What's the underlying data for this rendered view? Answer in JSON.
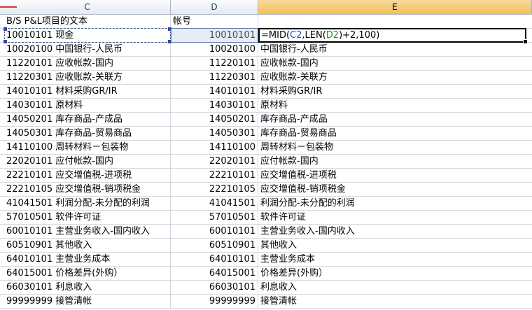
{
  "columns": {
    "C": "C",
    "D": "D",
    "E": "E"
  },
  "header_row": {
    "c": "B/S P&L项目的文本",
    "d": "帐号"
  },
  "formula": {
    "prefix": "=MID(",
    "ref1": "C2",
    "mid": ",LEN(",
    "ref2": "D2",
    "suffix": ")+2,100)"
  },
  "row2": {
    "c": "10010101 现金",
    "d": "10010101"
  },
  "rows": [
    {
      "c": "10020100 中国银行-人民币",
      "d": "10020100",
      "e": "中国银行-人民币"
    },
    {
      "c": "11220101 应收帐款-国内",
      "d": "11220101",
      "e": "应收帐款-国内"
    },
    {
      "c": "11220301 应收账款-关联方",
      "d": "11220301",
      "e": "应收账款-关联方"
    },
    {
      "c": "14010101 材料采购GR/IR",
      "d": "14010101",
      "e": "材料采购GR/IR"
    },
    {
      "c": "14030101 原材料",
      "d": "14030101",
      "e": "原材料"
    },
    {
      "c": "14050201 库存商品-产成品",
      "d": "14050201",
      "e": "库存商品-产成品"
    },
    {
      "c": "14050301 库存商品-贸易商品",
      "d": "14050301",
      "e": "库存商品-贸易商品"
    },
    {
      "c": "14110100 周转材料－包装物",
      "d": "14110100",
      "e": "周转材料－包装物"
    },
    {
      "c": "22020101 应付帐款-国内",
      "d": "22020101",
      "e": "应付帐款-国内"
    },
    {
      "c": "22210101 应交增值税-进项税",
      "d": "22210101",
      "e": "应交增值税-进项税"
    },
    {
      "c": "22210105 应交增值税-销项税金",
      "d": "22210105",
      "e": "应交增值税-销项税金"
    },
    {
      "c": "41041501 利润分配-未分配的利润",
      "d": "41041501",
      "e": "利润分配-未分配的利润"
    },
    {
      "c": "57010501 软件许可证",
      "d": "57010501",
      "e": "软件许可证"
    },
    {
      "c": "60010101 主营业务收入-国内收入",
      "d": "60010101",
      "e": "主营业务收入-国内收入"
    },
    {
      "c": "60510901 其他收入",
      "d": "60510901",
      "e": "其他收入"
    },
    {
      "c": "64010101 主营业务成本",
      "d": "64010101",
      "e": "主营业务成本"
    },
    {
      "c": "64015001 价格差异(外购）",
      "d": "64015001",
      "e": "价格差异(外购）"
    },
    {
      "c": "66030101 利息收入",
      "d": "66030101",
      "e": "利息收入"
    },
    {
      "c": "99999999 接管清帐",
      "d": "99999999",
      "e": "接管清帐"
    }
  ],
  "colors": {
    "grid_line": "#d0d7e5",
    "header_border": "#9eb6ce",
    "active_header": "#f1c15f",
    "ref_c2": "#1f57c3",
    "ref_d2": "#2c8a2c"
  }
}
